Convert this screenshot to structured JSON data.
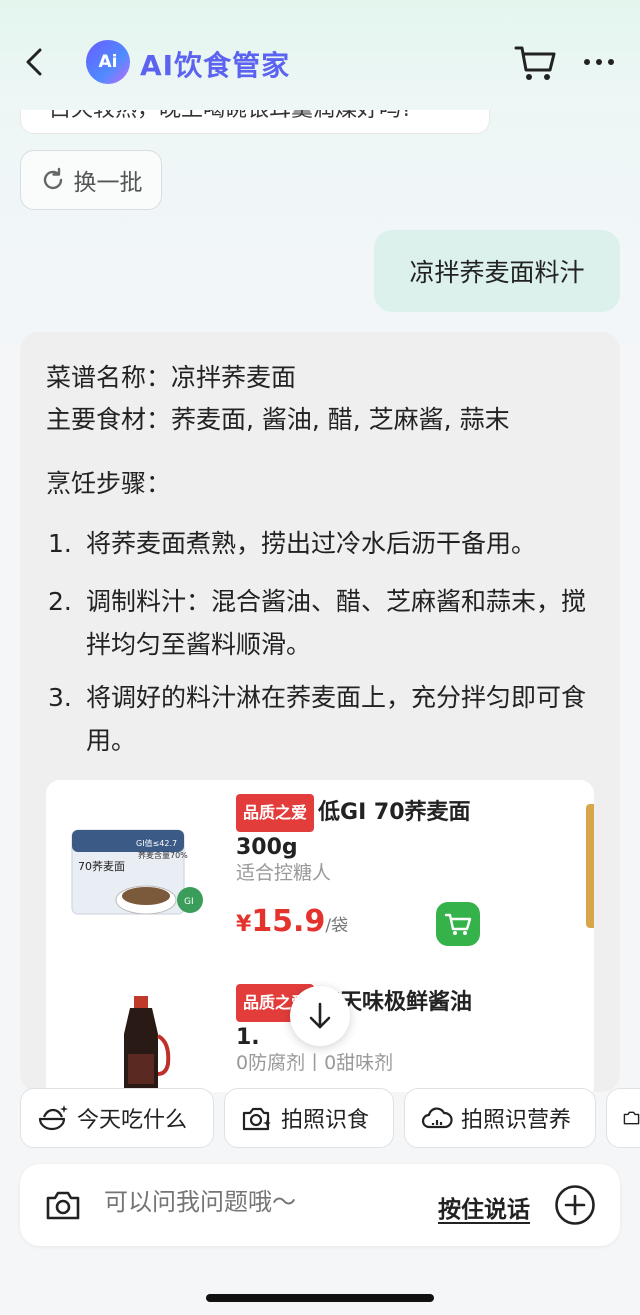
{
  "header": {
    "logo_text": "Ai",
    "title": "AI饮食管家"
  },
  "chat": {
    "previous_message_partial": "白天较热，晚上喝碗银耳羹润燥好吗?",
    "refresh_label": "换一批",
    "user_message": "凉拌荞麦面料汁",
    "answer": {
      "recipe_name_line": "菜谱名称：凉拌荞麦面",
      "ingredients_line": "主要食材：荞麦面, 酱油, 醋, 芝麻酱, 蒜末",
      "steps_heading": "烹饪步骤：",
      "steps": [
        {
          "num": "1.",
          "text": "将荞麦面煮熟，捞出过冷水后沥干备用。"
        },
        {
          "num": "2.",
          "text": "调制料汁：混合酱油、醋、芝麻酱和蒜末，搅拌均匀至酱料顺滑。"
        },
        {
          "num": "3.",
          "text": "将调好的料汁淋在荞麦面上，充分拌匀即可食用。"
        }
      ]
    },
    "products": [
      {
        "badge": "品质之爱",
        "title": "低GI 70荞麦面300g",
        "subtitle": "适合控糖人",
        "price_currency": "¥",
        "price": "15.9",
        "unit": "/袋",
        "image_text_a": "70荞麦面",
        "image_text_b": "GI值≤42.7",
        "image_text_c": "荞麦含量70%"
      },
      {
        "badge": "品质之爱",
        "title": "海天味极鲜酱油 1.",
        "subtitle": "0防腐剂丨0甜味剂"
      }
    ]
  },
  "quick_actions": [
    {
      "label": "今天吃什么",
      "icon": "bowl-sparkle-icon"
    },
    {
      "label": "拍照识食",
      "icon": "camera-sparkle-icon"
    },
    {
      "label": "拍照识营养",
      "icon": "cloud-sparkle-icon"
    }
  ],
  "input": {
    "placeholder": "可以问我问题哦～",
    "voice_label": "按住说话"
  },
  "colors": {
    "brand_purple": "#5b63f0",
    "user_bubble": "#dcf1ec",
    "price_red": "#e4322d",
    "cart_green": "#35b24a",
    "badge_red": "#e23d3b"
  }
}
